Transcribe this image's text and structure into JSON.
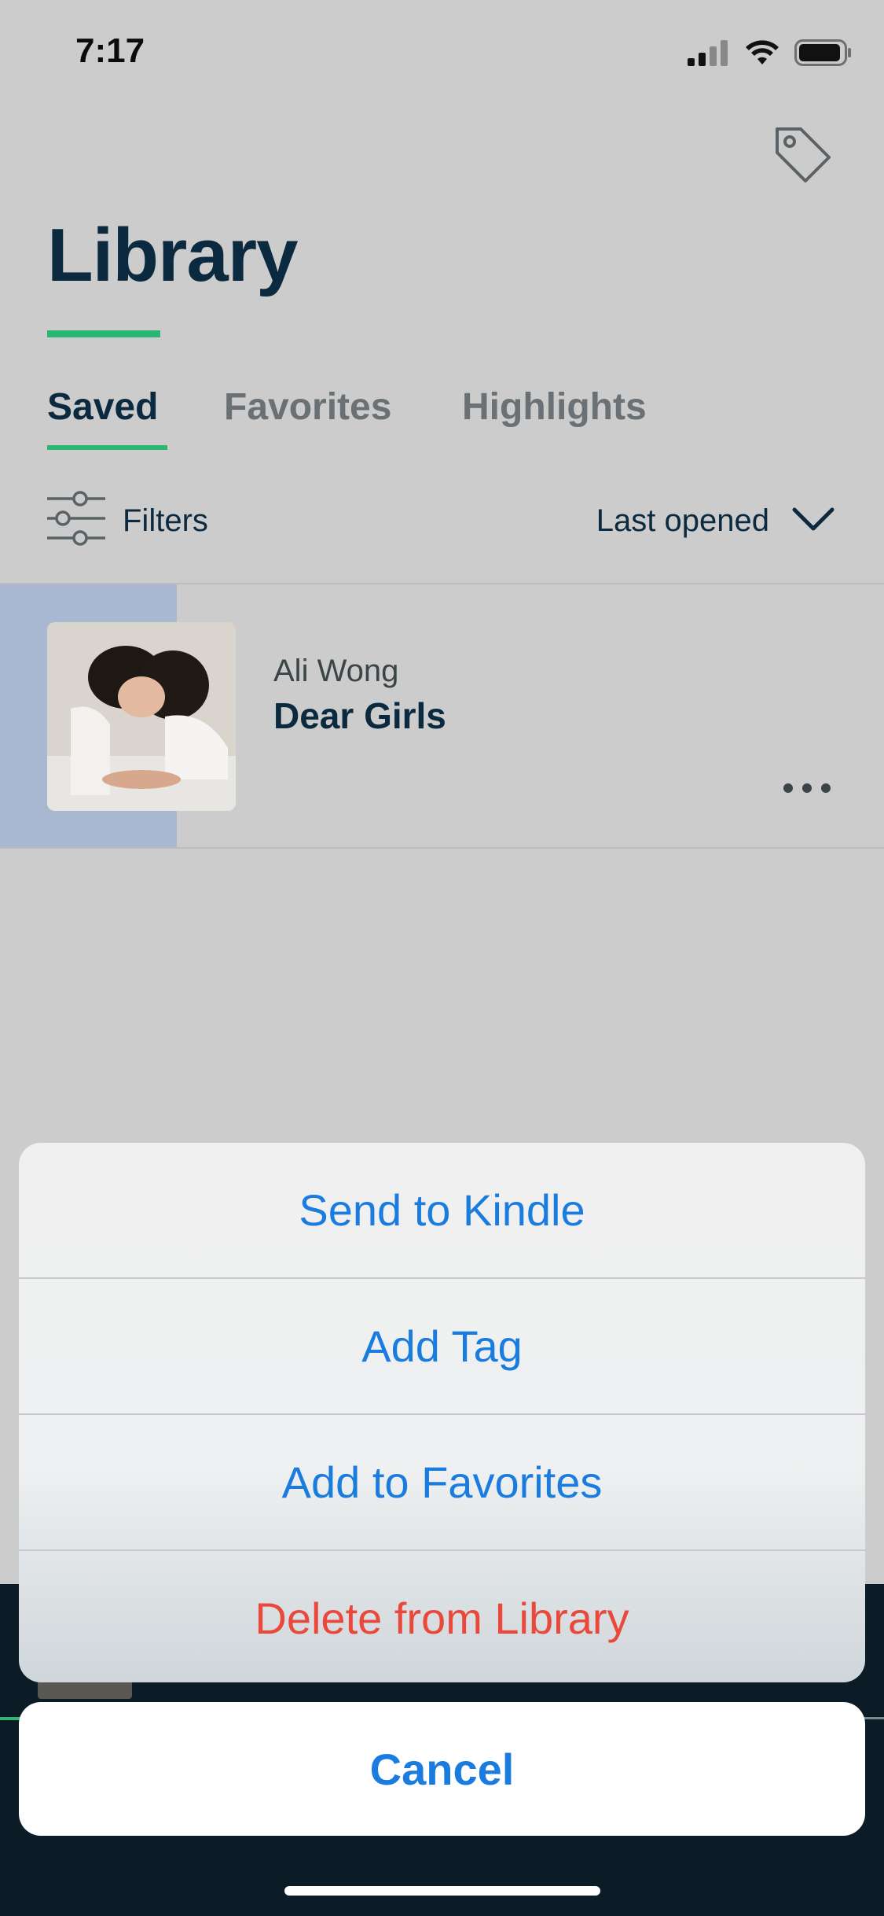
{
  "status_bar": {
    "time": "7:17"
  },
  "header": {
    "title": "Library"
  },
  "tabs": [
    {
      "label": "Saved",
      "active": true
    },
    {
      "label": "Favorites",
      "active": false
    },
    {
      "label": "Highlights",
      "active": false
    }
  ],
  "filters": {
    "label": "Filters",
    "sort_label": "Last opened"
  },
  "library_items": [
    {
      "author": "Ali Wong",
      "title": "Dear Girls"
    }
  ],
  "action_sheet": {
    "items": [
      {
        "label": "Send to Kindle"
      },
      {
        "label": "Add Tag"
      },
      {
        "label": "Add to Favorites"
      },
      {
        "label": "Delete from Library"
      }
    ],
    "cancel_label": "Cancel"
  },
  "colors": {
    "accent_green": "#2bb673",
    "title_navy": "#0c2a3f",
    "action_blue": "#1a7cdf",
    "destructive_red": "#e9483b"
  },
  "icons": [
    "signal-icon",
    "wifi-icon",
    "battery-icon",
    "tag-icon",
    "filter-sliders-icon",
    "chevron-down-icon",
    "more-dots-icon"
  ]
}
